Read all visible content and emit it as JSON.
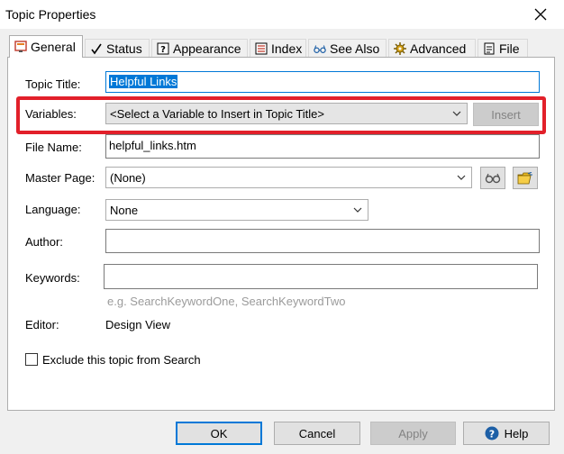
{
  "window": {
    "title": "Topic Properties"
  },
  "tabs": [
    {
      "label": "General",
      "icon": "general-icon"
    },
    {
      "label": "Status",
      "icon": "checkmark-icon"
    },
    {
      "label": "Appearance",
      "icon": "question-icon"
    },
    {
      "label": "Index",
      "icon": "index-icon"
    },
    {
      "label": "See Also",
      "icon": "glasses-icon"
    },
    {
      "label": "Advanced",
      "icon": "gear-icon"
    },
    {
      "label": "File",
      "icon": "file-icon"
    }
  ],
  "form": {
    "topic_title": {
      "label": "Topic Title:",
      "value": "Helpful Links"
    },
    "variables": {
      "label": "Variables:",
      "value": "<Select a Variable to Insert in Topic Title>",
      "insert_label": "Insert"
    },
    "file_name": {
      "label": "File Name:",
      "value": "helpful_links.htm"
    },
    "master_page": {
      "label": "Master Page:",
      "value": "(None)"
    },
    "language": {
      "label": "Language:",
      "value": "None"
    },
    "author": {
      "label": "Author:",
      "value": ""
    },
    "keywords": {
      "label": "Keywords:",
      "value": "",
      "hint": "e.g. SearchKeywordOne, SearchKeywordTwo"
    },
    "editor": {
      "label": "Editor:",
      "value": "Design View"
    },
    "exclude": {
      "label": "Exclude this topic from Search",
      "checked": false
    }
  },
  "footer": {
    "ok": "OK",
    "cancel": "Cancel",
    "apply": "Apply",
    "help": "Help"
  },
  "colors": {
    "highlight": "#e2202a",
    "accent": "#0078d7"
  }
}
